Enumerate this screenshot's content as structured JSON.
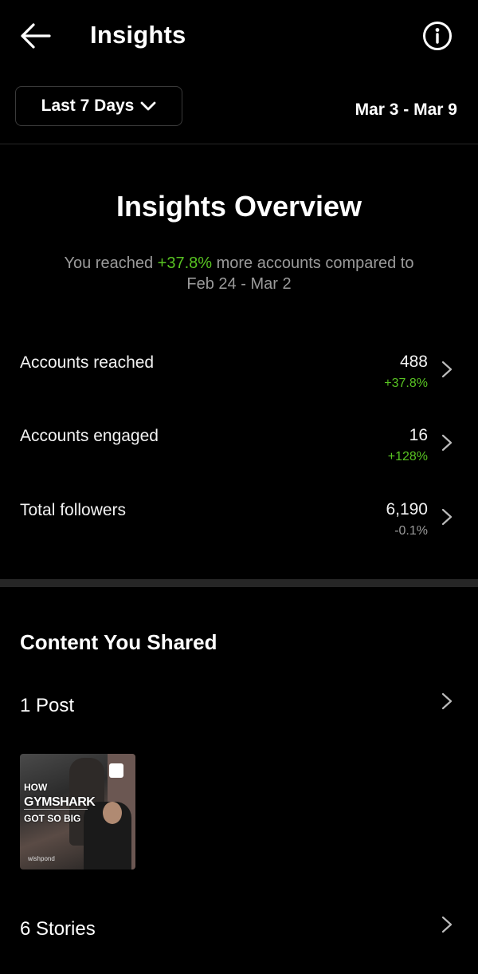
{
  "header": {
    "title": "Insights"
  },
  "range": {
    "label": "Last 7 Days",
    "dates": "Mar 3 - Mar 9"
  },
  "overview": {
    "title": "Insights Overview",
    "sub_prefix": "You reached ",
    "sub_change": "+37.8%",
    "sub_middle": " more accounts compared to",
    "sub_period": "Feb 24 - Mar 2",
    "metrics": [
      {
        "label": "Accounts reached",
        "value": "488",
        "change": "+37.8%",
        "change_color": "#58c322"
      },
      {
        "label": "Accounts engaged",
        "value": "16",
        "change": "+128%",
        "change_color": "#58c322"
      },
      {
        "label": "Total followers",
        "value": "6,190",
        "change": "-0.1%",
        "change_color": "#9a9a9a"
      }
    ]
  },
  "content": {
    "title": "Content You Shared",
    "posts_label": "1 Post",
    "thumb": {
      "line1": "HOW",
      "line2": "GYMSHARK",
      "line3": "GOT SO BIG",
      "brand": "wishpond"
    },
    "stories_label": "6 Stories"
  },
  "colors": {
    "background": "#000000",
    "positive": "#58c322",
    "muted": "#9a9a9a"
  },
  "icons": {
    "back": "back-arrow-icon",
    "info": "info-icon",
    "chevron": "chevron-right-icon",
    "dropdown": "chevron-down-icon"
  }
}
